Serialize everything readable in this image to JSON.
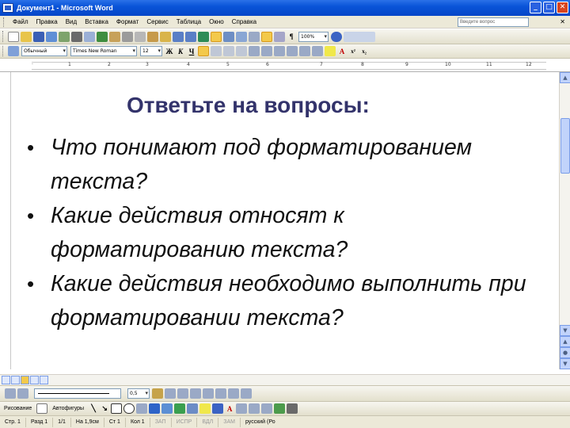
{
  "window": {
    "title": "Документ1 - Microsoft Word"
  },
  "menubar": {
    "items": [
      "Файл",
      "Правка",
      "Вид",
      "Вставка",
      "Формат",
      "Сервис",
      "Таблица",
      "Окно",
      "Справка"
    ],
    "help_placeholder": "Введите вопрос"
  },
  "formatting": {
    "style": "Обычный",
    "font": "Times New Roman",
    "size": "12",
    "zoom": "100%"
  },
  "document": {
    "heading": "Ответьте на вопросы:",
    "bullets": [
      "Что понимают под форматированием текста?",
      "Какие действия относят к форматированию текста?",
      "Какие действия необходимо выполнить при форматировании текста?"
    ]
  },
  "drawing": {
    "draw_label": "Рисование",
    "autoshapes_label": "Автофигуры",
    "line_width": "0,5"
  },
  "statusbar": {
    "page": "Стр. 1",
    "section": "Разд 1",
    "pages": "1/1",
    "position": "На 1,9см",
    "line": "Ст 1",
    "column": "Кол 1",
    "modes": [
      "ЗАП",
      "ИСПР",
      "ВДЛ",
      "ЗАМ"
    ],
    "language": "русский (Ро"
  },
  "colors": {
    "titlebar": "#0a54d8",
    "heading": "#33336b",
    "toolbar": "#ece9d8"
  }
}
